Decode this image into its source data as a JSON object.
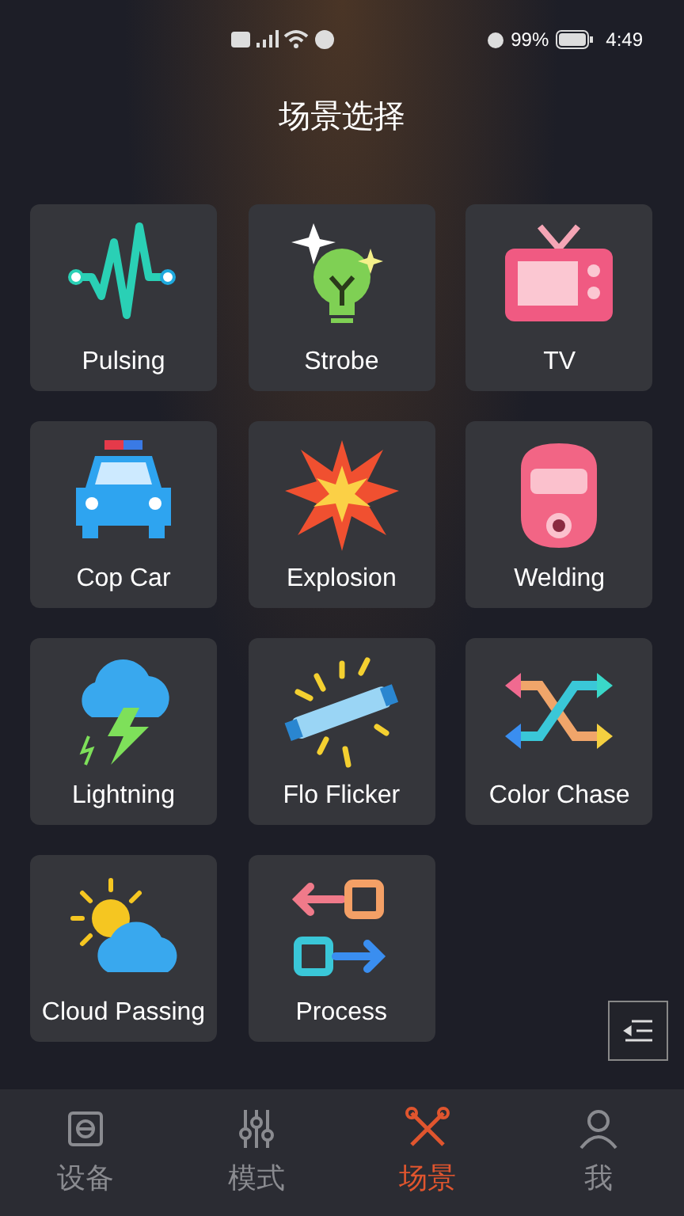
{
  "status_bar": {
    "battery": "99%",
    "time": "4:49"
  },
  "title": "场景选择",
  "scenes": [
    {
      "label": "Pulsing",
      "kind": "pulse"
    },
    {
      "label": "Strobe",
      "kind": "strobe"
    },
    {
      "label": "TV",
      "kind": "tv"
    },
    {
      "label": "Cop Car",
      "kind": "police"
    },
    {
      "label": "Explosion",
      "kind": "explosion"
    },
    {
      "label": "Welding",
      "kind": "welding"
    },
    {
      "label": "Lightning",
      "kind": "lightning"
    },
    {
      "label": "Flo Flicker",
      "kind": "tube"
    },
    {
      "label": "Color Chase",
      "kind": "shuffle"
    },
    {
      "label": "Cloud Passing",
      "kind": "cloudsun"
    },
    {
      "label": "Process",
      "kind": "process"
    }
  ],
  "nav": [
    {
      "label": "设备",
      "kind": "device",
      "selected": false
    },
    {
      "label": "模式",
      "kind": "sliders",
      "selected": false
    },
    {
      "label": "场景",
      "kind": "scene",
      "selected": true
    },
    {
      "label": "我",
      "kind": "person",
      "selected": false
    }
  ]
}
